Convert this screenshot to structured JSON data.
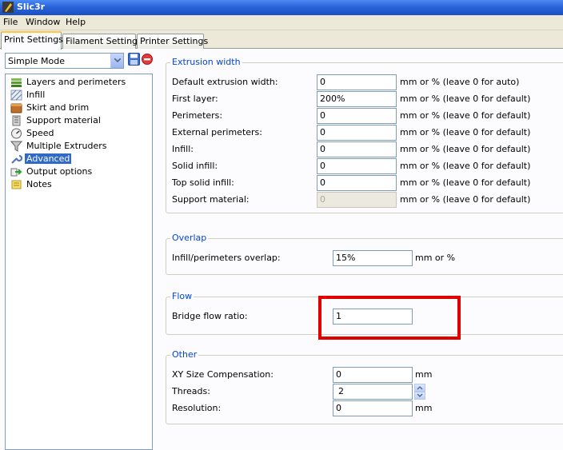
{
  "window": {
    "title": "Slic3r",
    "icon": "slic3r-logo-icon"
  },
  "menu": [
    "File",
    "Window",
    "Help"
  ],
  "tabs": [
    {
      "label": "Print Settings",
      "active": true
    },
    {
      "label": "Filament Settings",
      "active": false
    },
    {
      "label": "Printer Settings",
      "active": false
    }
  ],
  "preset": {
    "selected": "Simple Mode"
  },
  "tree": [
    {
      "label": "Layers and perimeters",
      "icon": "layers-icon",
      "selected": false
    },
    {
      "label": "Infill",
      "icon": "infill-icon",
      "selected": false
    },
    {
      "label": "Skirt and brim",
      "icon": "skirt-brim-icon",
      "selected": false
    },
    {
      "label": "Support material",
      "icon": "support-material-icon",
      "selected": false
    },
    {
      "label": "Speed",
      "icon": "speed-icon",
      "selected": false
    },
    {
      "label": "Multiple Extruders",
      "icon": "funnel-icon",
      "selected": false
    },
    {
      "label": "Advanced",
      "icon": "wrench-icon",
      "selected": true
    },
    {
      "label": "Output options",
      "icon": "output-arrow-icon",
      "selected": false
    },
    {
      "label": "Notes",
      "icon": "notes-icon",
      "selected": false
    }
  ],
  "extrusion_width": {
    "title": "Extrusion width",
    "rows": [
      {
        "label": "Default extrusion width:",
        "value": "0",
        "unit": "mm or % (leave 0 for auto)",
        "disabled": false
      },
      {
        "label": "First layer:",
        "value": "200%",
        "unit": "mm or % (leave 0 for default)",
        "disabled": false
      },
      {
        "label": "Perimeters:",
        "value": "0",
        "unit": "mm or % (leave 0 for default)",
        "disabled": false
      },
      {
        "label": "External perimeters:",
        "value": "0",
        "unit": "mm or % (leave 0 for default)",
        "disabled": false
      },
      {
        "label": "Infill:",
        "value": "0",
        "unit": "mm or % (leave 0 for default)",
        "disabled": false
      },
      {
        "label": "Solid infill:",
        "value": "0",
        "unit": "mm or % (leave 0 for default)",
        "disabled": false
      },
      {
        "label": "Top solid infill:",
        "value": "0",
        "unit": "mm or % (leave 0 for default)",
        "disabled": false
      },
      {
        "label": "Support material:",
        "value": "0",
        "unit": "mm or % (leave 0 for default)",
        "disabled": true
      }
    ]
  },
  "overlap": {
    "title": "Overlap",
    "label": "Infill/perimeters overlap:",
    "value": "15%",
    "unit": "mm or %"
  },
  "flow": {
    "title": "Flow",
    "label": "Bridge flow ratio:",
    "value": "1"
  },
  "other": {
    "title": "Other",
    "xy_label": "XY Size Compensation:",
    "xy_value": "0",
    "xy_unit": "mm",
    "threads_label": "Threads:",
    "threads_value": "2",
    "resolution_label": "Resolution:",
    "resolution_value": "0",
    "resolution_unit": "mm"
  },
  "colors": {
    "accent": "#0046d5",
    "selection": "#316ac5",
    "highlight": "#e00000",
    "titlebar": "#2a63d8"
  }
}
